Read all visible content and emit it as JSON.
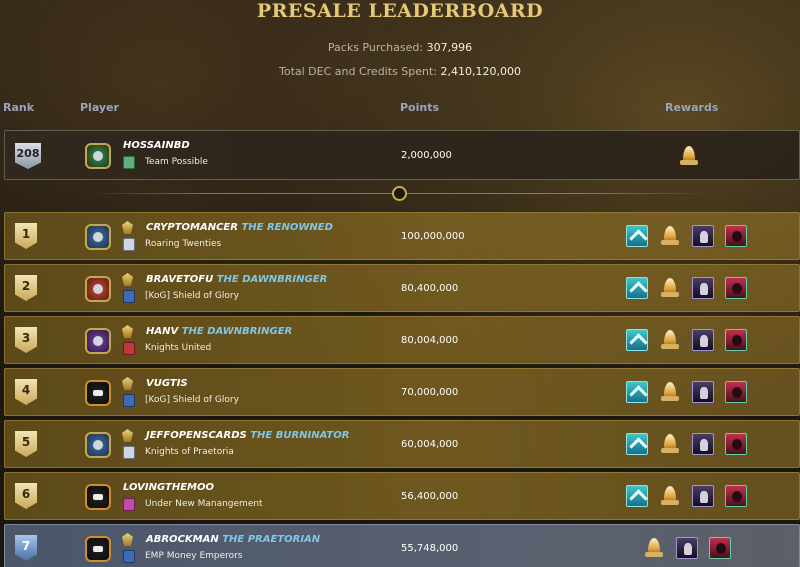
{
  "header": {
    "title": "PRESALE LEADERBOARD",
    "packs_label": "Packs Purchased:",
    "packs_value": "307,996",
    "spent_label": "Total DEC and Credits Spent:",
    "spent_value": "2,410,120,000"
  },
  "columns": {
    "rank": "Rank",
    "player": "Player",
    "points": "Points",
    "rewards": "Rewards"
  },
  "current_user": {
    "rank": "208",
    "name": "HOSSAINBD",
    "guild": "Team Possible",
    "points": "2,000,000",
    "rewards": [
      "flame-trophy-icon"
    ]
  },
  "rows": [
    {
      "rank": "1",
      "name": "CRYPTOMANCER",
      "rtitle": "THE RENOWNED",
      "guild": "Roaring Twenties",
      "points": "100,000,000"
    },
    {
      "rank": "2",
      "name": "BRAVETOFU",
      "rtitle": "THE DAWNBRINGER",
      "guild": "[KoG] Shield of Glory",
      "points": "80,400,000"
    },
    {
      "rank": "3",
      "name": "HANV",
      "rtitle": "THE DAWNBRINGER",
      "guild": "Knights United",
      "points": "80,004,000"
    },
    {
      "rank": "4",
      "name": "VUGTIS",
      "rtitle": "",
      "guild": "[KoG] Shield of Glory",
      "points": "70,000,000"
    },
    {
      "rank": "5",
      "name": "JEFFOPENSCARDS",
      "rtitle": "THE BURNINATOR",
      "guild": "Knights of Praetoria",
      "points": "60,004,000"
    },
    {
      "rank": "6",
      "name": "LOVINGTHEMOO",
      "rtitle": "",
      "guild": "Under New Manangement",
      "points": "56,400,000"
    },
    {
      "rank": "7",
      "name": "ABROCKMAN",
      "rtitle": "THE PRAETORIAN",
      "guild": "EMP Money Emperors",
      "points": "55,748,000"
    }
  ],
  "colors": {
    "title_gold": "#e6c978",
    "reward_title_blue": "#7fc7e8",
    "row_gold": "#7e6422",
    "row_blue": "#5a6478"
  }
}
